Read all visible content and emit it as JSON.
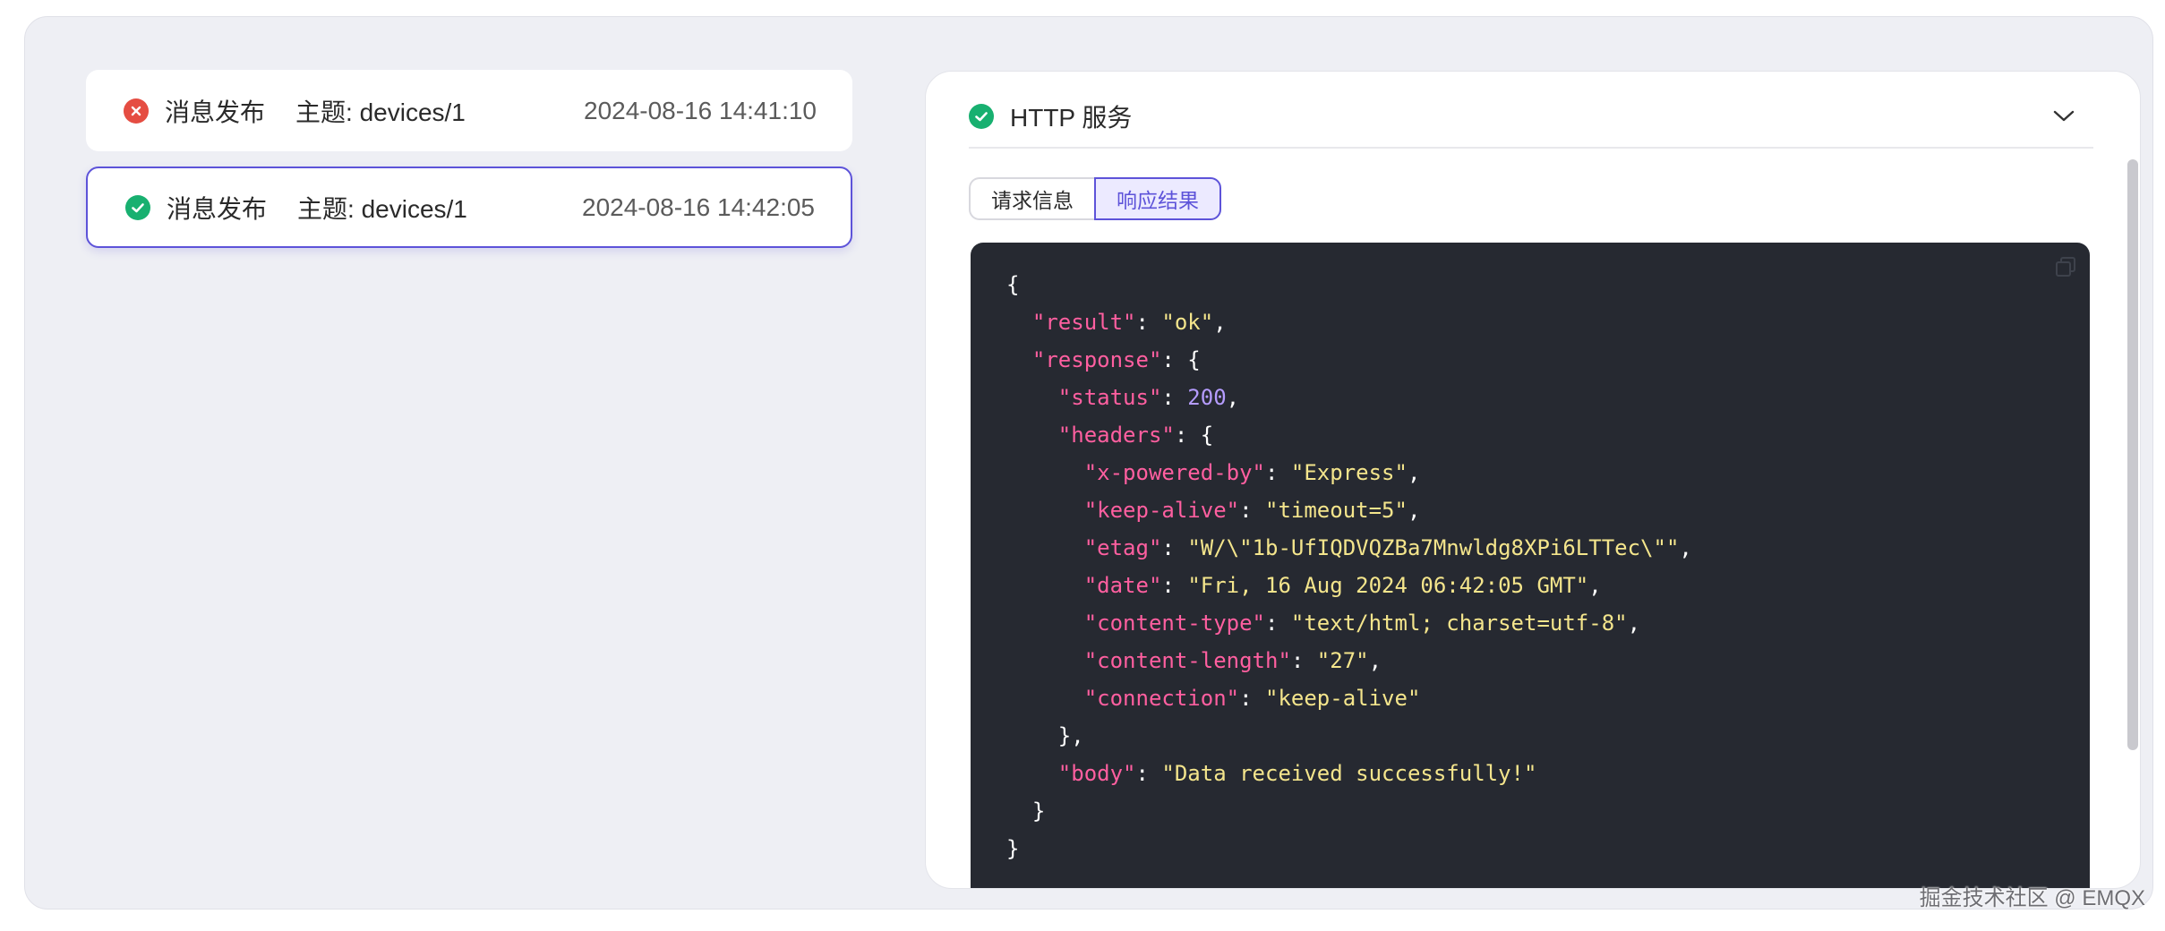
{
  "messages": [
    {
      "status": "error",
      "action": "消息发布",
      "topic": "主题: devices/1",
      "time": "2024-08-16 14:41:10"
    },
    {
      "status": "success",
      "action": "消息发布",
      "topic": "主题: devices/1",
      "time": "2024-08-16 14:42:05"
    }
  ],
  "panel": {
    "title": "HTTP 服务",
    "tabs": [
      "请求信息",
      "响应结果"
    ],
    "active_tab": "响应结果"
  },
  "code": {
    "result": "ok",
    "status": 200,
    "x_powered_by": "Express",
    "keep_alive": "timeout=5",
    "etag": "W/\\\"1b-UfIQDVQZBa7Mnwldg8XPi6LTTec\\\"",
    "date": "Fri, 16 Aug 2024 06:42:05 GMT",
    "content_type": "text/html; charset=utf-8",
    "content_length": "27",
    "connection": "keep-alive",
    "body": "Data received successfully!"
  },
  "watermark": "掘金技术社区 @ EMQX",
  "colors": {
    "accent": "#5d53d9",
    "success": "#18b070",
    "error": "#e54d42",
    "code_bg": "#262931",
    "code_key": "#ff5fa0",
    "code_string": "#f4e58c",
    "code_number": "#b59cff"
  }
}
